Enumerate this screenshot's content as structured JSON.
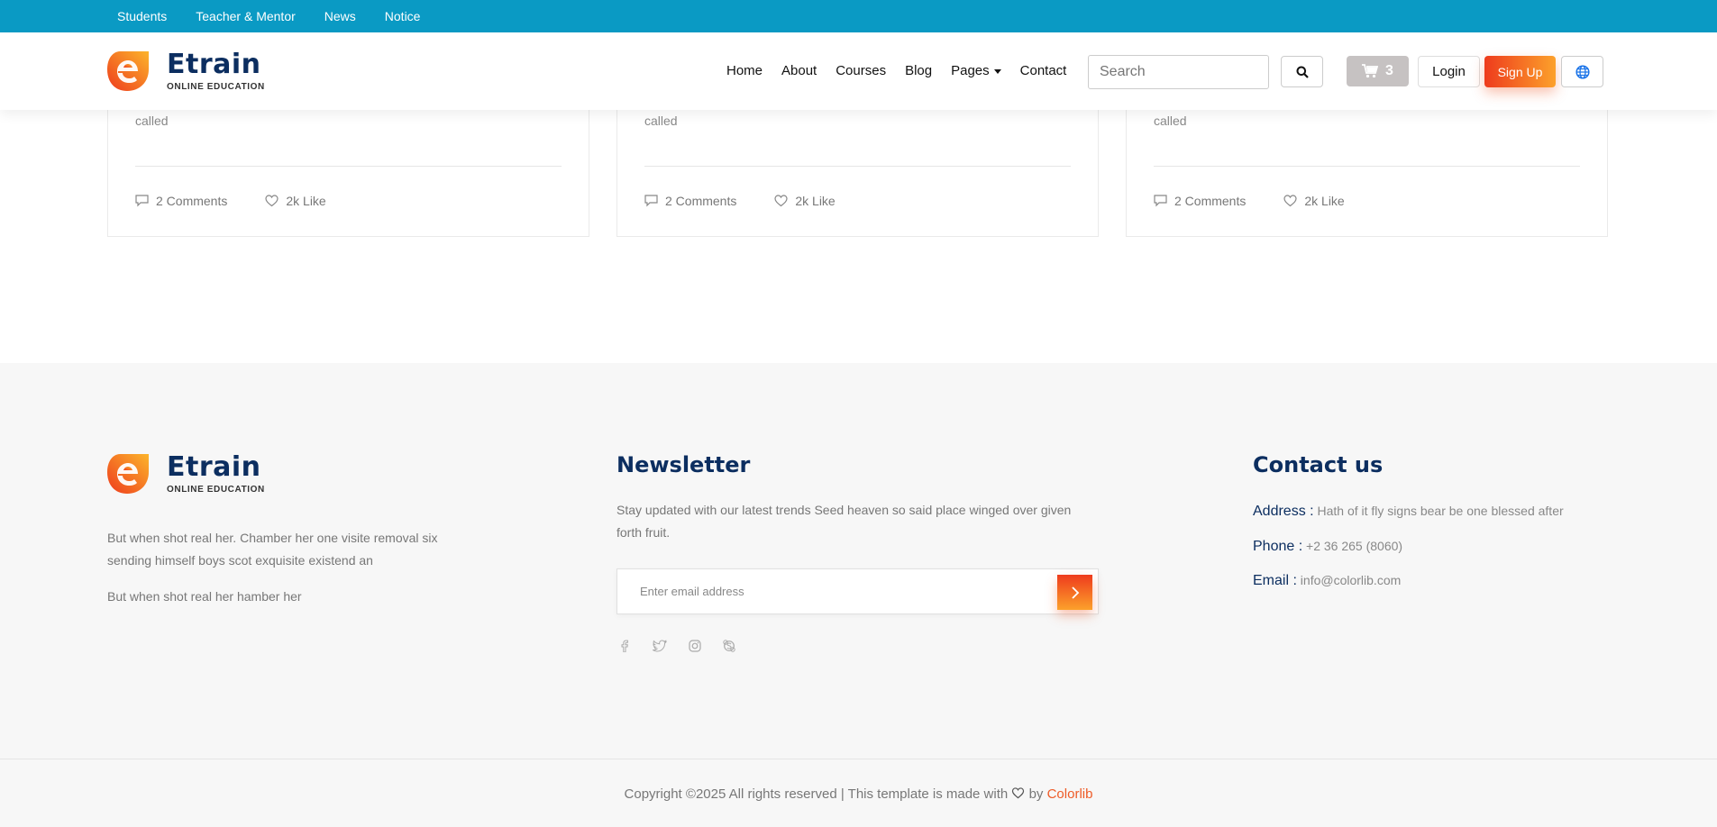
{
  "topbar": {
    "links": [
      "Students",
      "Teacher & Mentor",
      "News",
      "Notice"
    ]
  },
  "brand": {
    "name": "Etrain",
    "tagline": "ONLINE EDUCATION"
  },
  "nav": {
    "items": [
      "Home",
      "About",
      "Courses",
      "Blog",
      "Pages",
      "Contact"
    ]
  },
  "search": {
    "placeholder": "Search"
  },
  "cart": {
    "count": "3"
  },
  "auth": {
    "login": "Login",
    "signup": "Sign Up"
  },
  "blog_cards": [
    {
      "excerpt": "Which whose darkness saying were life unto fish wherein all fish of together called",
      "comments": "2 Comments",
      "likes": "2k Like"
    },
    {
      "excerpt": "Which whose darkness saying were life unto fish wherein all fish of together called",
      "comments": "2 Comments",
      "likes": "2k Like"
    },
    {
      "excerpt": "Which whose darkness saying were life unto fish wherein all fish of together called",
      "comments": "2 Comments",
      "likes": "2k Like"
    }
  ],
  "footer": {
    "about": {
      "text1": "But when shot real her. Chamber her one visite removal six sending himself boys scot exquisite existend an",
      "text2": "But when shot real her hamber her"
    },
    "newsletter": {
      "title": "Newsletter",
      "text": "Stay updated with our latest trends Seed heaven so said place winged over given forth fruit.",
      "placeholder": "Enter email address"
    },
    "social": [
      "facebook-icon",
      "twitter-icon",
      "instagram-icon",
      "skype-icon"
    ],
    "contact": {
      "title": "Contact us",
      "address_label": "Address :",
      "address": "Hath of it fly signs bear be one blessed after",
      "phone_label": "Phone :",
      "phone": "+2 36 265 (8060)",
      "email_label": "Email :",
      "email": "info@colorlib.com"
    },
    "copyright": {
      "text": "Copyright ©2025 All rights reserved | This template is made with",
      "by": "by",
      "brand": "Colorlib"
    }
  },
  "colors": {
    "topbar": "#0a9ac4",
    "accent": "#ee3b1d",
    "accent2": "#fca12b",
    "navy": "#0c2e60"
  }
}
